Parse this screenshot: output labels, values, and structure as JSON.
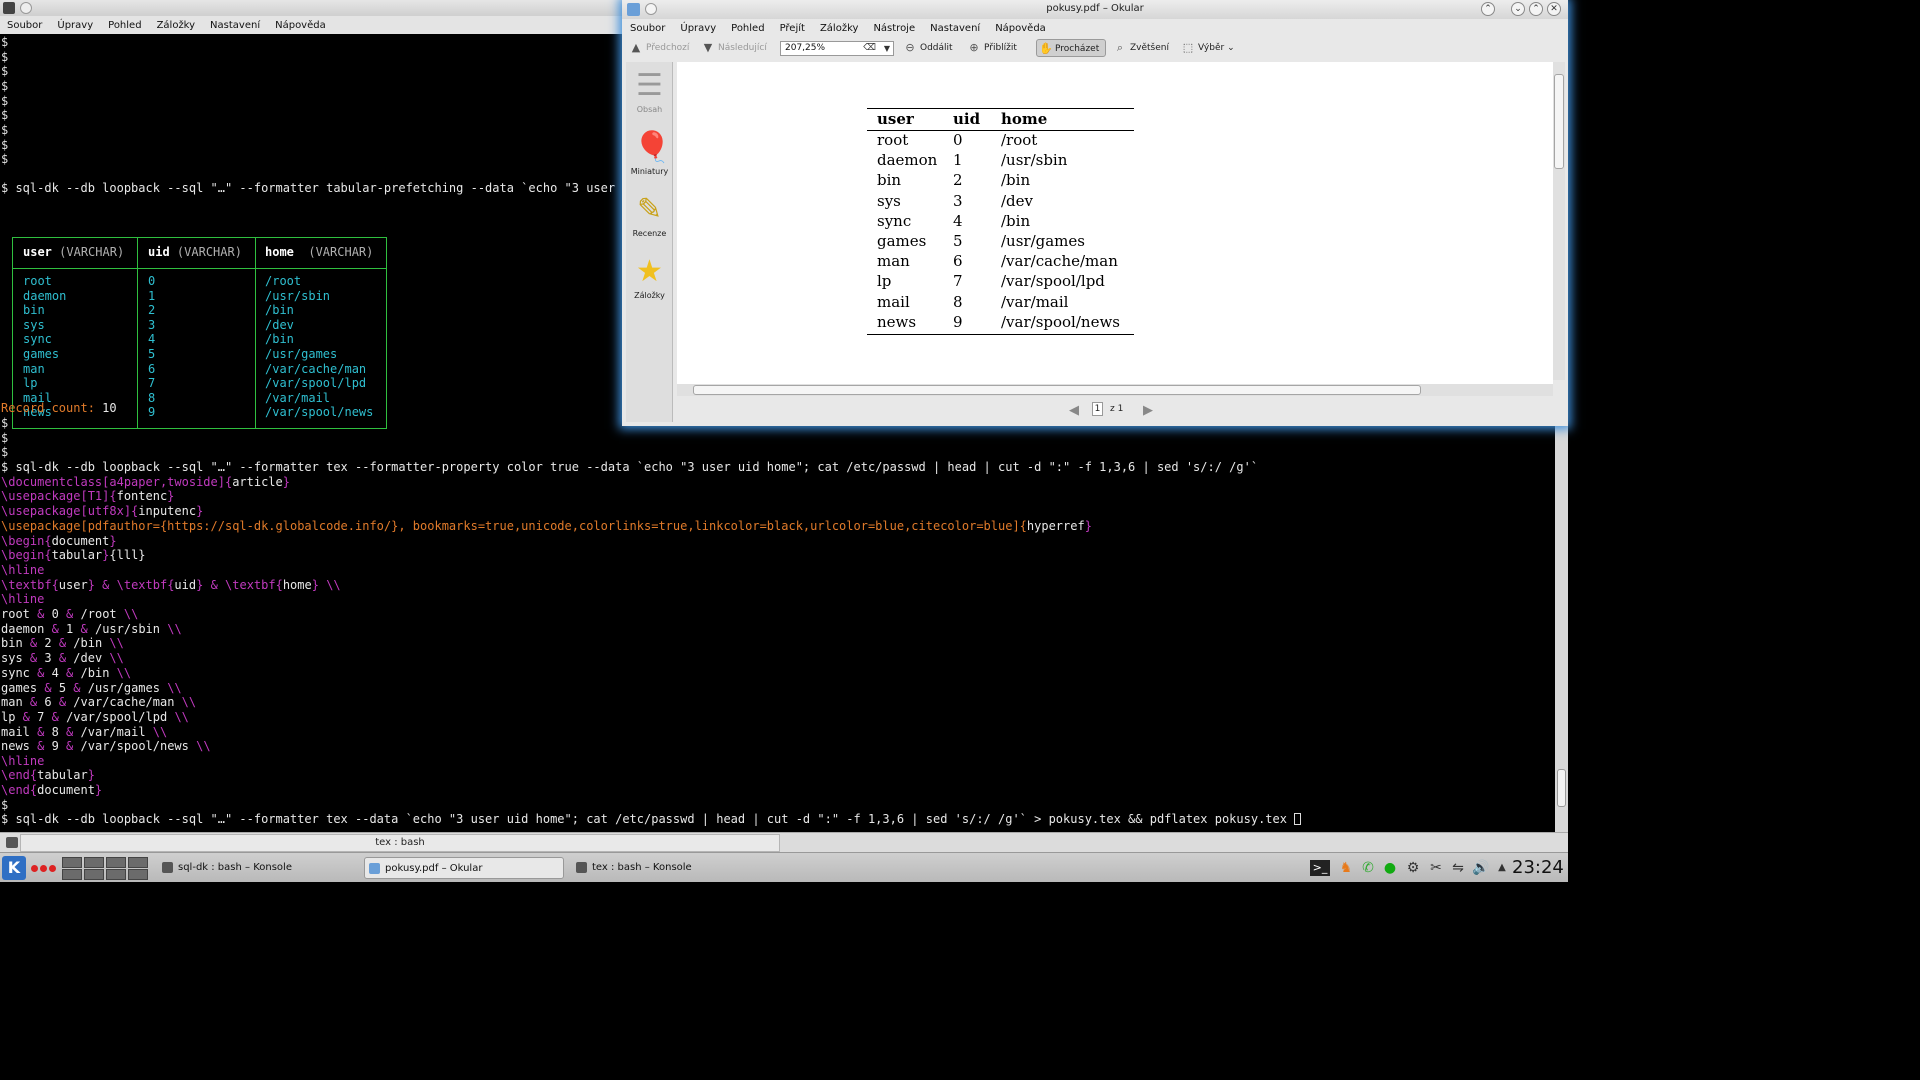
{
  "konsole": {
    "menu": [
      "Soubor",
      "Úpravy",
      "Pohled",
      "Záložky",
      "Nastavení",
      "Nápověda"
    ],
    "tab_label": "tex : bash"
  },
  "terminal": {
    "prompt": "$",
    "cmd1": "$ sql-dk --db loopback --sql \"…\" --formatter tabular-prefetching --data `echo \"3 user",
    "sql_headers": [
      {
        "name": "user",
        "type": "(VARCHAR)"
      },
      {
        "name": "uid",
        "type": "(VARCHAR)"
      },
      {
        "name": "home",
        "type": "(VARCHAR)"
      }
    ],
    "rows": [
      [
        "root",
        "0",
        "/root"
      ],
      [
        "daemon",
        "1",
        "/usr/sbin"
      ],
      [
        "bin",
        "2",
        "/bin"
      ],
      [
        "sys",
        "3",
        "/dev"
      ],
      [
        "sync",
        "4",
        "/bin"
      ],
      [
        "games",
        "5",
        "/usr/games"
      ],
      [
        "man",
        "6",
        "/var/cache/man"
      ],
      [
        "lp",
        "7",
        "/var/spool/lpd"
      ],
      [
        "mail",
        "8",
        "/var/mail"
      ],
      [
        "news",
        "9",
        "/var/spool/news"
      ]
    ],
    "record_count_label": "Record count:",
    "record_count": "10",
    "cmd2": "$ sql-dk --db loopback --sql \"…\" --formatter tex --formatter-property color true --data `echo \"3 user uid home\"; cat /etc/passwd | head | cut -d \":\" -f 1,3,6 | sed 's/:/ /g'`",
    "tex": {
      "l1_cmd": "\\documentclass[a4paper,twoside]{",
      "l1_arg": "article",
      "l1_end": "}",
      "l2_cmd": "\\usepackage[T1]{",
      "l2_arg": "fontenc",
      "l3_cmd": "\\usepackage[utf8x]{",
      "l3_arg": "inputenc",
      "l4_cmd": "\\usepackage[pdfauthor={https://sql-dk.globalcode.info/}, bookmarks=true,unicode,colorlinks=true,linkcolor=black,urlcolor=blue,citecolor=blue]{",
      "l4_arg": "hyperref",
      "begin": "\\begin{",
      "end": "\\end{",
      "document": "document",
      "tabular": "tabular",
      "tabular_spec": "{lll}",
      "hline": "\\hline",
      "textbf": "\\textbf{",
      "amp": " & ",
      "eol": " \\\\",
      "header_cells": [
        "user",
        "uid",
        "home"
      ]
    },
    "cmd3": "$ sql-dk --db loopback --sql \"…\" --formatter tex --data `echo \"3 user uid home\"; cat /etc/passwd | head | cut -d \":\" -f 1,3,6 | sed 's/:/ /g'` > pokusy.tex && pdflatex pokusy.tex"
  },
  "okular": {
    "title": "pokusy.pdf – Okular",
    "menu": [
      "Soubor",
      "Úpravy",
      "Pohled",
      "Přejít",
      "Záložky",
      "Nástroje",
      "Nastavení",
      "Nápověda"
    ],
    "toolbar": {
      "prev": "Předchozí",
      "next": "Následující",
      "zoom": "207,25%",
      "zoom_out": "Oddálit",
      "zoom_in": "Přiblížit",
      "browse": "Procházet",
      "magnify": "Zvětšení",
      "select": "Výběr"
    },
    "sidebar": [
      "Obsah",
      "Miniatury",
      "Recenze",
      "Záložky"
    ],
    "pdf": {
      "headers": [
        "user",
        "uid",
        "home"
      ]
    },
    "page": {
      "current": "1",
      "of": "z 1"
    }
  },
  "taskbar": {
    "tasks": [
      "sql-dk : bash – Konsole",
      "pokusy.pdf – Okular",
      "tex : bash – Konsole"
    ],
    "clock": "23:24"
  },
  "colors": {
    "table_border": "#2fbf3f",
    "cell_text": "#2fbfd0",
    "tex_command": "#c13abf",
    "tex_option": "#e07a2a",
    "okular_glow": "#3d8fdc"
  }
}
